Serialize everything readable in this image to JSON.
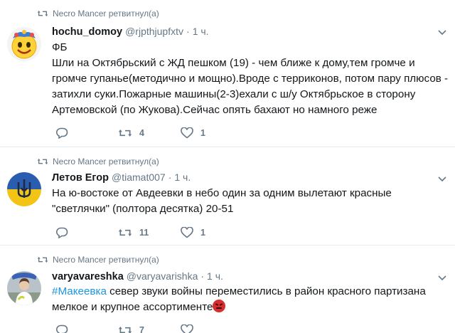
{
  "tweets": [
    {
      "retweeted_by": "Necro Mancer ретвитнул(а)",
      "name": "hochu_domoy",
      "handle": "@rjpthjupfxtv",
      "time": "1 ч.",
      "avatar_icon": "smiley-emoji-avatar",
      "text": "ФБ\nШли на Октябрьский с ЖД пешком (19) - чем ближе к дому,тем громче и громче гупанье(методично и мощно).Вроде с терриконов, потом пару плюсов - затихли суки.Пожарные машины(2-3)ехали с ш/у Октябрьское в сторону  Артемовской (по  Жукова).Сейчас опять бахают но намного реже",
      "retweets": "4",
      "likes": "1"
    },
    {
      "retweeted_by": "Necro Mancer ретвитнул(а)",
      "name": "Летов Егор",
      "handle": "@tiamat007",
      "time": "1 ч.",
      "avatar_icon": "blue-yellow-trident-avatar",
      "text": "На ю-востоке от Авдеевки в небо один за одним вылетают красные \"светлячки\" (полтора десятка) 20-51",
      "retweets": "11",
      "likes": "1"
    },
    {
      "retweeted_by": "Necro Mancer ретвитнул(а)",
      "name": "varyavareshka",
      "handle": "@varyavarishka",
      "time": "1 ч.",
      "avatar_icon": "person-photo-avatar",
      "hashtag": "#Макеевка",
      "text": " север звуки войны переместились в район красного партизана мелкое и крупное ассортименте",
      "retweets": "7",
      "likes": ""
    }
  ],
  "colors": {
    "text": "#14171a",
    "secondary": "#657786",
    "link": "#1b95e0",
    "divider": "#e6ecf0"
  },
  "icons": [
    "retweet-icon",
    "reply-icon",
    "heart-icon",
    "chevron-down-icon",
    "angry-face-emoji"
  ]
}
